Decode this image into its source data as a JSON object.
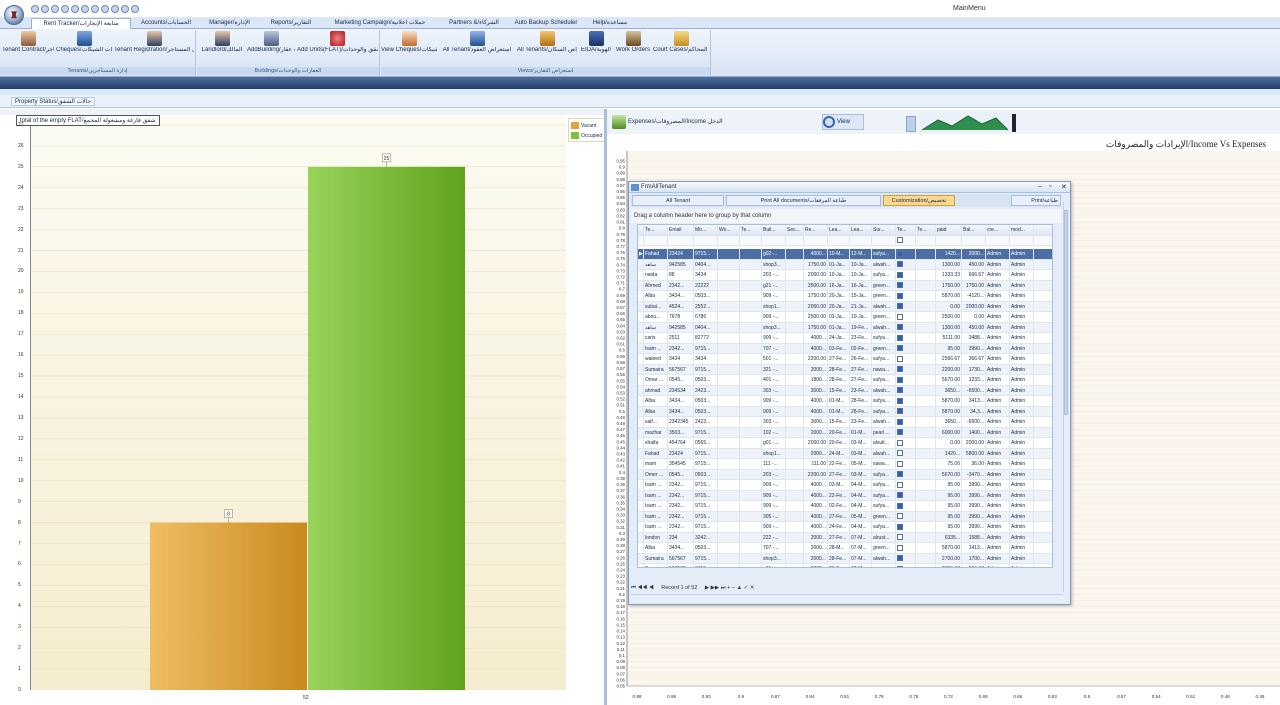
{
  "window": {
    "title": "MainMenu"
  },
  "tabs": [
    "Rent Tracker/متابعة الإيجارات",
    "Accounts/الحسابات",
    "Manager/الإدارة",
    "Reports/التقارير",
    "Marketing Campaign/حملات اعلانية",
    "Partners &/الشركاء",
    "Auto Backup Scheduler",
    "Help/مساعدة"
  ],
  "ribbon": {
    "groups": [
      {
        "label": "Tenants/إدارة المستأجرين",
        "buttons": [
          "Tenant Contract/عقد المستأجر",
          "Cheques/بيانات الشيكات",
          "Tenant Registration/تسجيل المستأجر"
        ]
      },
      {
        "label": "Buildings/العقارات والوحدات",
        "buttons": [
          "Landlord/المالك",
          "AddBuilding/اضافة عقار",
          "Add Units(FLAT)/اضافة الشقق والوحدات"
        ]
      },
      {
        "label": "Views/استعراض التقارير",
        "buttons": [
          "View Cheques/كشف دفعات الشيكات",
          "All Tenant/استعراض العقود",
          "All Tenants/استعراض السكان",
          "EIDA/الهوية",
          "Work Orders",
          "Court Cases/قضايا المحاكم"
        ]
      }
    ]
  },
  "property_status_button": "Property Status/حالات الشقق",
  "left_chart": {
    "hint": "total of the empty FLAT/شقق فارغة ومشغولة المجمع",
    "legend": [
      "Vacant",
      "Occupied"
    ]
  },
  "right_toolbar": {
    "expenses_button": "Expenses/المصروفات/Income الدخل",
    "view_button": "View"
  },
  "dialog": {
    "title": "FrmAllTenant",
    "tabs": [
      "All Tenant",
      "Print All documents/طباعة المرفقات",
      "Customization/تخصيص",
      "Print/طباعة"
    ],
    "group_hint": "Drag a column header here to group by that column",
    "columns": [
      "Te...",
      "Email",
      "Mo...",
      "Wo...",
      "Te...",
      "Buil...",
      "Sec...",
      "Re...",
      "Lea...",
      "Lea...",
      "Sur...",
      "Te...",
      "Te...",
      "paid",
      "Bal...",
      "cre...",
      "mod..."
    ],
    "rows": [
      [
        "Fahad",
        "23424",
        "9715...",
        "",
        "",
        "g02-...",
        "",
        "4000...",
        "10-M...",
        "12-M...",
        "sufya...",
        "true",
        "",
        "1420...",
        "2000...",
        "Admin",
        "Admin"
      ],
      [
        "ساهد",
        "942585",
        "0404...",
        "",
        "",
        "shop3...",
        "",
        "1750.00",
        "01-Ja...",
        "10-Ja...",
        "alwah...",
        "true",
        "",
        "1300.00",
        "450.00",
        "Admin",
        "Admin"
      ],
      [
        "naida",
        "88",
        "3434",
        "",
        "",
        "203 -...",
        "",
        "2000.00",
        "10-Ja...",
        "10-Ja...",
        "sufya...",
        "true",
        "",
        "1333.33",
        "666.67",
        "Admin",
        "Admin"
      ],
      [
        "Ahmed",
        "2342...",
        "22222",
        "",
        "",
        "g21 -...",
        "",
        "3500.00",
        "16-Ja...",
        "16-Ja...",
        "green...",
        "true",
        "",
        "1750.00",
        "1750.00",
        "Admin",
        "Admin"
      ],
      [
        "Alba",
        "3434...",
        "0503...",
        "",
        "",
        "909 -...",
        "",
        "1750.00",
        "20-Ja...",
        "15-Ja...",
        "green...",
        "true",
        "",
        "5870.00",
        "-4120...",
        "Admin",
        "Admin"
      ],
      [
        "subai...",
        "4524...",
        "2552...",
        "",
        "",
        "shop1...",
        "",
        "2000.00",
        "20-Ja...",
        "21-Ja...",
        "alwah...",
        "true",
        "",
        "0.00",
        "2000.00",
        "Admin",
        "Admin"
      ],
      [
        "abou...",
        "7678",
        "6786",
        "",
        "",
        "909 -...",
        "",
        "2500.00",
        "03-Ja...",
        "10-Ja...",
        "green...",
        "false",
        "",
        "2500.00",
        "0.00",
        "Admin",
        "Admin"
      ],
      [
        "ساهد",
        "942585",
        "0404...",
        "",
        "",
        "shop3...",
        "",
        "1750.00",
        "01-Ja...",
        "19-Fe...",
        "alwah...",
        "true",
        "",
        "1300.00",
        "450.00",
        "Admin",
        "Admin"
      ],
      [
        "caris",
        "2511",
        "82772",
        "",
        "",
        "909 -...",
        "",
        "4000...",
        "24-Ja...",
        "23-Fe...",
        "sufya...",
        "true",
        "",
        "5111.00",
        "3488...",
        "Admin",
        "Admin"
      ],
      [
        "Isam ...",
        "2342...",
        "9715...",
        "",
        "",
        "707 -...",
        "",
        "4000...",
        "03-Fe...",
        "02-Fe...",
        "green...",
        "true",
        "",
        "95.00",
        "3990...",
        "Admin",
        "Admin"
      ],
      [
        "waleed",
        "3434",
        "3434",
        "",
        "",
        "501 -...",
        "",
        "2200.00",
        "27-Fe...",
        "26-Fe...",
        "sufya...",
        "false",
        "",
        "2566.67",
        "366.67",
        "Admin",
        "Admin"
      ],
      [
        "Sumaira",
        "567567",
        "9715...",
        "",
        "",
        "321 -...",
        "",
        "2000...",
        "28-Fe...",
        "27-Fe...",
        "nawa...",
        "true",
        "",
        "2200.00",
        "1730...",
        "Admin",
        "Admin"
      ],
      [
        "Omar ...",
        "0545...",
        "0503...",
        "",
        "",
        "401 -...",
        "",
        "1800...",
        "28-Fe...",
        "27-Fe...",
        "sufya...",
        "true",
        "",
        "5670.00",
        "1233...",
        "Admin",
        "Admin"
      ],
      [
        "ahmad",
        "234534",
        "2423...",
        "",
        "",
        "303 -...",
        "",
        "3000...",
        "15-Fe...",
        "23-Fe...",
        "alwah...",
        "true",
        "",
        "3650...",
        "-6500...",
        "Admin",
        "Admin"
      ],
      [
        "Alba",
        "3434...",
        "0503...",
        "",
        "",
        "909 -...",
        "",
        "4000...",
        "01-M...",
        "28-Fe...",
        "sufya...",
        "true",
        "",
        "5870.00",
        "3413...",
        "Admin",
        "Admin"
      ],
      [
        "Alba",
        "3434...",
        "0503...",
        "",
        "",
        "909 -...",
        "",
        "4000...",
        "01-M...",
        "28-Fe...",
        "sufya...",
        "true",
        "",
        "5870.00",
        "34,3...",
        "Admin",
        "Admin"
      ],
      [
        "saif...",
        "2342345",
        "2423...",
        "",
        "",
        "303 -...",
        "",
        "3000...",
        "15-Fe...",
        "23-Fe...",
        "alwah...",
        "true",
        "",
        "3650...",
        "-6500...",
        "Admin",
        "Admin"
      ],
      [
        "mazhar",
        "3503...",
        "9715...",
        "",
        "",
        "102 -...",
        "",
        "2000...",
        "20-Fe...",
        "01-M...",
        "pearl ...",
        "true",
        "",
        "6000.00",
        "1400...",
        "Admin",
        "Admin"
      ],
      [
        "shaifa",
        "454764",
        "0565...",
        "",
        "",
        "g01 -...",
        "",
        "2000.00",
        "20-Fe...",
        "03-M...",
        "alsult...",
        "false",
        "",
        "0.00",
        "2000.00",
        "Admin",
        "Admin"
      ],
      [
        "Fahad",
        "23424",
        "9715...",
        "",
        "",
        "shop1...",
        "",
        "2000...",
        "24-M...",
        "03-M...",
        "alwah...",
        "false",
        "",
        "1420...",
        "5800.00",
        "Admin",
        "Admin"
      ],
      [
        "mam",
        "354545",
        "9715...",
        "",
        "",
        "111 -...",
        "",
        "111.00",
        "22-Fe...",
        "05-M...",
        "sawa...",
        "false",
        "",
        "75.00",
        "36.00",
        "Admin",
        "Admin"
      ],
      [
        "Omer ...",
        "0545...",
        "0503...",
        "",
        "",
        "203 -...",
        "",
        "2200.00",
        "27-Fe...",
        "03-M...",
        "sufya...",
        "true",
        "",
        "5670.00",
        "-3470...",
        "Admin",
        "Admin"
      ],
      [
        "Isam ...",
        "2342...",
        "9715...",
        "",
        "",
        "909 -...",
        "",
        "4000...",
        "03-M...",
        "04-M...",
        "sufya...",
        "false",
        "",
        "95.00",
        "3990...",
        "Admin",
        "Admin"
      ],
      [
        "Isam ...",
        "2342...",
        "9715...",
        "",
        "",
        "909 -...",
        "",
        "4000...",
        "22-Fe...",
        "04-M...",
        "sufya...",
        "true",
        "",
        "95.00",
        "3990...",
        "Admin",
        "Admin"
      ],
      [
        "Isam ...",
        "2342...",
        "9715...",
        "",
        "",
        "909 -...",
        "",
        "4000...",
        "02-Fe...",
        "04-M...",
        "sufya...",
        "true",
        "",
        "95.00",
        "3990...",
        "Admin",
        "Admin"
      ],
      [
        "Isam ...",
        "2342...",
        "9715...",
        "",
        "",
        "305 -...",
        "",
        "4000...",
        "27-Fe...",
        "05-M...",
        "green...",
        "false",
        "",
        "95.00",
        "3990...",
        "Admin",
        "Admin"
      ],
      [
        "Isam ...",
        "2342...",
        "9715...",
        "",
        "",
        "909 -...",
        "",
        "4000...",
        "24-Fe...",
        "04-M...",
        "sufya...",
        "true",
        "",
        "95.00",
        "3990...",
        "Admin",
        "Admin"
      ],
      [
        "london",
        "234",
        "3242...",
        "",
        "",
        "222 -...",
        "",
        "2000...",
        "27-Fe...",
        "07-M...",
        "alrust...",
        "false",
        "",
        "6335...",
        "1588...",
        "Admin",
        "Admin"
      ],
      [
        "Alba",
        "3434...",
        "0503...",
        "",
        "",
        "707 -...",
        "",
        "2000...",
        "28-M...",
        "07-M...",
        "green...",
        "false",
        "",
        "5870.00",
        "1413...",
        "Admin",
        "Admin"
      ],
      [
        "Sumaira",
        "567567",
        "9715...",
        "",
        "",
        "shop3...",
        "",
        "2000...",
        "28-Fe...",
        "07-M...",
        "alwah...",
        "true",
        "",
        "2700.00",
        "1700...",
        "Admin",
        "Admin"
      ],
      [
        "Sumaira",
        "567567",
        "9715...",
        "",
        "",
        "g01 -...",
        "",
        "2000...",
        "28-Fe...",
        "07-M...",
        "green...",
        "false",
        "",
        "2700.00",
        "800.00",
        "Admin",
        "Admin"
      ]
    ],
    "footer_total": "Total...",
    "record_nav": "Record 1 of 52"
  },
  "colors": {
    "vacant": "#e3a43a",
    "occupied": "#7ec13a",
    "band": "#2e4a76",
    "selection": "#4b6fa4"
  },
  "chart_data": [
    {
      "type": "bar",
      "categories": [
        "52"
      ],
      "series": [
        {
          "name": "Vacant",
          "values": [
            8
          ]
        },
        {
          "name": "Occupied",
          "values": [
            25
          ]
        }
      ],
      "data_labels": [
        "8",
        "25"
      ],
      "y_ticks": [
        "0",
        "1",
        "2",
        "3",
        "4",
        "5",
        "6",
        "7",
        "8",
        "9",
        "10",
        "11",
        "12",
        "13",
        "14",
        "15",
        "16",
        "17",
        "18",
        "19",
        "20",
        "21",
        "22",
        "23",
        "24",
        "25",
        "26",
        "27"
      ],
      "ylim": [
        0,
        27
      ],
      "legend_position": "top-right",
      "grid": true
    },
    {
      "type": "line",
      "title": "الإيرادات والمصروفات/Income Vs Expenses",
      "y_ticks": [
        "0.95",
        "0.9",
        "0.89",
        "0.88",
        "0.87",
        "0.86",
        "0.85",
        "0.84",
        "0.83",
        "0.82",
        "0.81",
        "0.8",
        "0.79",
        "0.78",
        "0.77",
        "0.76",
        "0.75",
        "0.74",
        "0.73",
        "0.72",
        "0.71",
        "0.7",
        "0.69",
        "0.68",
        "0.67",
        "0.66",
        "0.65",
        "0.64",
        "0.63",
        "0.62",
        "0.61",
        "0.6",
        "0.59",
        "0.58",
        "0.57",
        "0.56",
        "0.55",
        "0.54",
        "0.53",
        "0.52",
        "0.51",
        "0.5",
        "0.49",
        "0.48",
        "0.47",
        "0.46",
        "0.45",
        "0.44",
        "0.43",
        "0.42",
        "0.41",
        "0.4",
        "0.39",
        "0.38",
        "0.37",
        "0.36",
        "0.35",
        "0.34",
        "0.33",
        "0.32",
        "0.31",
        "0.3",
        "0.29",
        "0.28",
        "0.27",
        "0.26",
        "0.25",
        "0.24",
        "0.23",
        "0.22",
        "0.21",
        "0.2",
        "0.19",
        "0.18",
        "0.17",
        "0.16",
        "0.15",
        "0.14",
        "0.13",
        "0.12",
        "0.11",
        "0.1",
        "0.09",
        "0.08",
        "0.07",
        "0.06",
        "0.05"
      ],
      "x_ticks": [
        "0.99",
        "0.96",
        "0.93",
        "0.9",
        "0.87",
        "0.84",
        "0.81",
        "0.78",
        "0.75",
        "0.72",
        "0.69",
        "0.66",
        "0.63",
        "0.6",
        "0.57",
        "0.54",
        "0.51",
        "0.48",
        "0.45"
      ],
      "grid": true
    }
  ]
}
